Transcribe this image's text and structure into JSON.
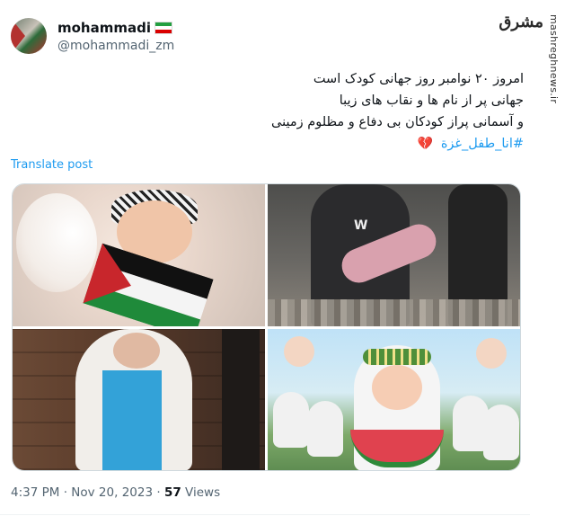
{
  "author": {
    "display_name": "mohammadi",
    "handle": "@mohammadi_zm",
    "flag_icon": "iran-flag-icon"
  },
  "watermark": {
    "logo_text": "مشرق",
    "url": "mashreghnews.ir"
  },
  "tweet": {
    "lines": [
      "امروز ۲۰ نوامبر روز جهانی کودک است",
      "جهانی پر از نام ها و نقاب های زیبا",
      "و آسمانی  پراز کودکان بی دفاع و مظلوم زمینی"
    ],
    "hashtag": "#انا_طفل_غزة",
    "hashtag_color": "#1d9bf0",
    "emoji": "broken-heart-icon"
  },
  "translate_label": "Translate post",
  "media": {
    "count": 4,
    "items": [
      "image-1",
      "image-2",
      "image-3",
      "image-4"
    ]
  },
  "meta": {
    "time": "4:37 PM",
    "separator": "·",
    "date": "Nov 20, 2023",
    "views_count": "57",
    "views_label": "Views"
  }
}
